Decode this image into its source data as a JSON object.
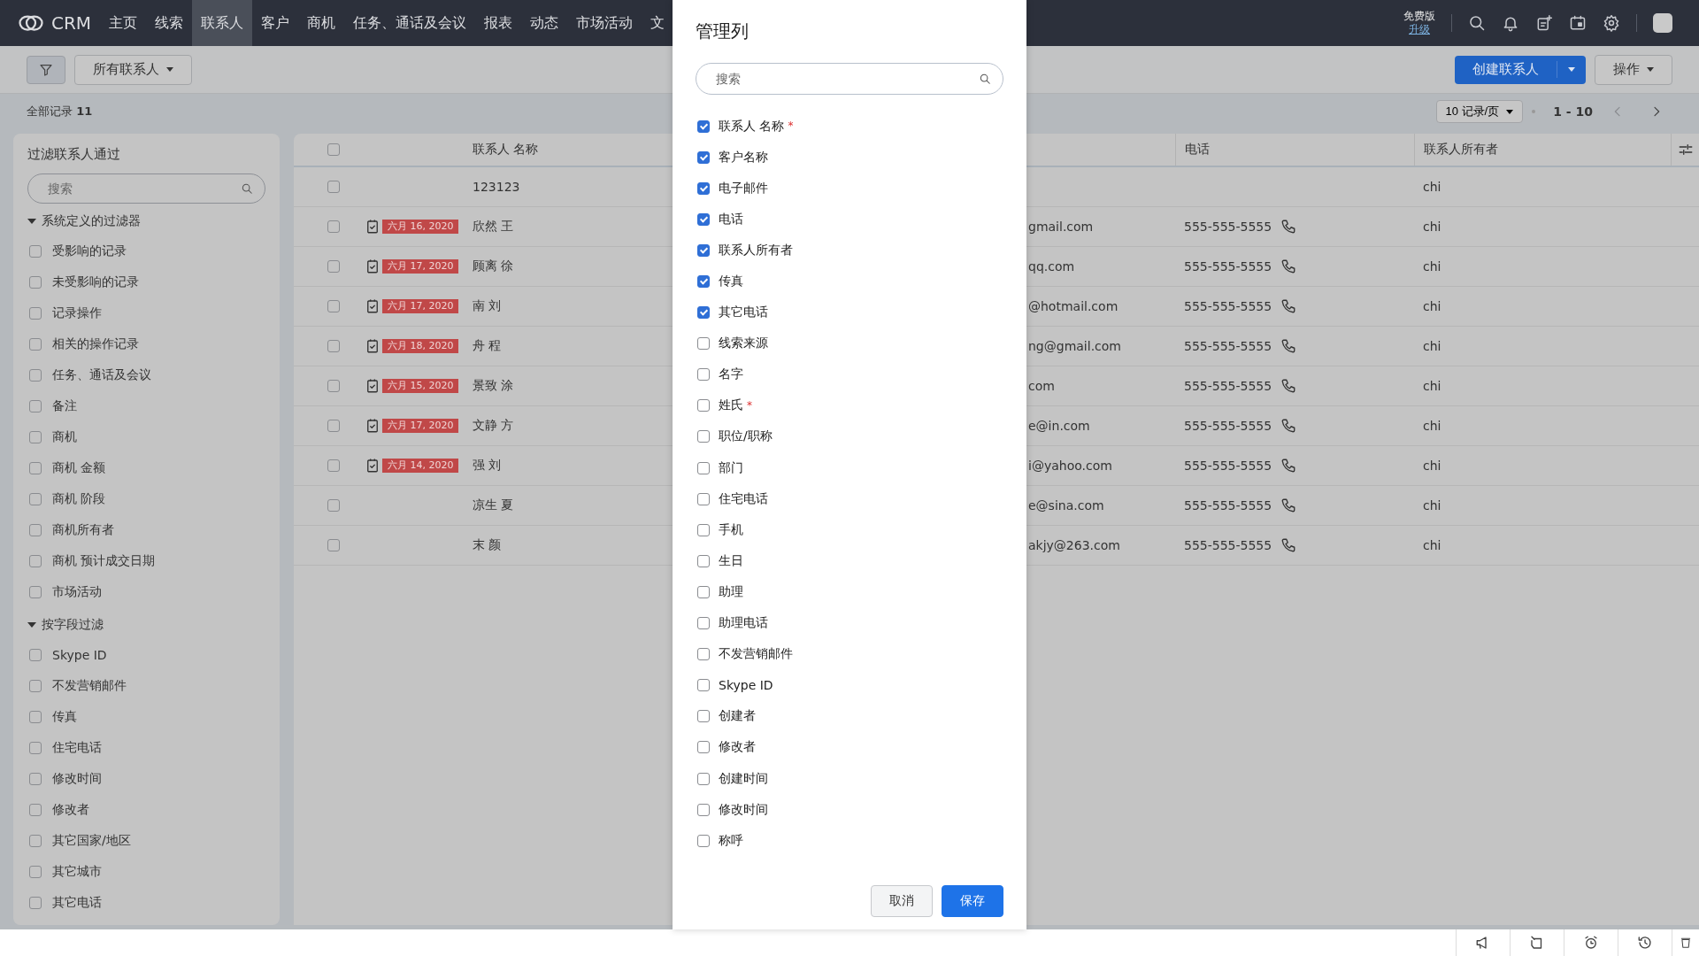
{
  "nav": {
    "logo": "CRM",
    "items": [
      {
        "label": "主页",
        "selected": false
      },
      {
        "label": "线索",
        "selected": false
      },
      {
        "label": "联系人",
        "selected": true
      },
      {
        "label": "客户",
        "selected": false
      },
      {
        "label": "商机",
        "selected": false
      },
      {
        "label": "任务、通话及会议",
        "selected": false
      },
      {
        "label": "报表",
        "selected": false
      },
      {
        "label": "动态",
        "selected": false
      },
      {
        "label": "市场活动",
        "selected": false
      },
      {
        "label": "文",
        "selected": false
      }
    ],
    "plan": "免费版",
    "upgrade": "升级"
  },
  "toolbar": {
    "view": "所有联系人",
    "create": "创建联系人",
    "actions": "操作"
  },
  "summary": {
    "records": "全部记录 **11**",
    "per_page": "10 记录/页",
    "range": "1 - 10"
  },
  "sidebar": {
    "title": "过滤联系人通过",
    "search_placeholder": "搜索",
    "sections": [
      {
        "title": "系统定义的过滤器",
        "expanded": true,
        "items": [
          {
            "label": "受影响的记录",
            "checked": false
          },
          {
            "label": "未受影响的记录",
            "checked": false
          },
          {
            "label": "记录操作",
            "checked": false
          },
          {
            "label": "相关的操作记录",
            "checked": false
          },
          {
            "label": "任务、通话及会议",
            "checked": false
          },
          {
            "label": "备注",
            "checked": false
          },
          {
            "label": "商机",
            "checked": false
          },
          {
            "label": "商机 金额",
            "checked": false
          },
          {
            "label": "商机 阶段",
            "checked": false
          },
          {
            "label": "商机所有者",
            "checked": false
          },
          {
            "label": "商机 预计成交日期",
            "checked": false
          },
          {
            "label": "市场活动",
            "checked": false
          }
        ]
      },
      {
        "title": "按字段过滤",
        "expanded": true,
        "items": [
          {
            "label": "Skype ID",
            "checked": false
          },
          {
            "label": "不发营销邮件",
            "checked": false
          },
          {
            "label": "传真",
            "checked": false
          },
          {
            "label": "住宅电话",
            "checked": false
          },
          {
            "label": "修改时间",
            "checked": false
          },
          {
            "label": "修改者",
            "checked": false
          },
          {
            "label": "其它国家/地区",
            "checked": false
          },
          {
            "label": "其它城市",
            "checked": false
          },
          {
            "label": "其它电话",
            "checked": false
          }
        ]
      }
    ]
  },
  "table": {
    "header_checked": false,
    "columns": [
      "联系人 名称",
      "电话",
      "联系人所有者"
    ],
    "rows": [
      {
        "checked": false,
        "name": "123123",
        "email": "",
        "phone": "",
        "owner": "chi"
      },
      {
        "checked": false,
        "task_date": "六月 16, 2020",
        "name": "欣然 王",
        "email": "gmail.com",
        "phone": "555-555-5555",
        "owner": "chi"
      },
      {
        "checked": false,
        "task_date": "六月 17, 2020",
        "name": "顾离 徐",
        "email": "qq.com",
        "phone": "555-555-5555",
        "owner": "chi"
      },
      {
        "checked": false,
        "task_date": "六月 17, 2020",
        "name": "南 刘",
        "email": "@hotmail.com",
        "phone": "555-555-5555",
        "owner": "chi"
      },
      {
        "checked": false,
        "task_date": "六月 18, 2020",
        "name": "舟 程",
        "email": "ng@gmail.com",
        "phone": "555-555-5555",
        "owner": "chi"
      },
      {
        "checked": false,
        "task_date": "六月 15, 2020",
        "name": "景致 涂",
        "email": "com",
        "phone": "555-555-5555",
        "owner": "chi"
      },
      {
        "checked": false,
        "task_date": "六月 17, 2020",
        "name": "文静 方",
        "email": "e@in.com",
        "phone": "555-555-5555",
        "owner": "chi"
      },
      {
        "checked": false,
        "task_date": "六月 14, 2020",
        "name": "强 刘",
        "email": "i@yahoo.com",
        "phone": "555-555-5555",
        "owner": "chi"
      },
      {
        "checked": false,
        "name": "凉生 夏",
        "email": "e@sina.com",
        "phone": "555-555-5555",
        "owner": "chi"
      },
      {
        "checked": false,
        "name": "末 颜",
        "email": "akjy@263.com",
        "phone": "555-555-5555",
        "owner": "chi"
      }
    ]
  },
  "dialog": {
    "title": "管理列",
    "search_placeholder": "搜索",
    "fields": [
      {
        "label": "联系人 名称",
        "required_mark": "*",
        "checked": true
      },
      {
        "label": "客户名称",
        "checked": true
      },
      {
        "label": "电子邮件",
        "checked": true
      },
      {
        "label": "电话",
        "checked": true
      },
      {
        "label": "联系人所有者",
        "checked": true
      },
      {
        "label": "传真",
        "checked": true
      },
      {
        "label": "其它电话",
        "checked": true
      },
      {
        "label": "线索来源",
        "checked": false
      },
      {
        "label": "名字",
        "checked": false
      },
      {
        "label": "姓氏",
        "required_mark": "*",
        "checked": false
      },
      {
        "label": "职位/职称",
        "checked": false
      },
      {
        "label": "部门",
        "checked": false
      },
      {
        "label": "住宅电话",
        "checked": false
      },
      {
        "label": "手机",
        "checked": false
      },
      {
        "label": "生日",
        "checked": false
      },
      {
        "label": "助理",
        "checked": false
      },
      {
        "label": "助理电话",
        "checked": false
      },
      {
        "label": "不发营销邮件",
        "checked": false
      },
      {
        "label": "Skype ID",
        "checked": false
      },
      {
        "label": "创建者",
        "checked": false
      },
      {
        "label": "修改者",
        "checked": false
      },
      {
        "label": "创建时间",
        "checked": false
      },
      {
        "label": "修改时间",
        "checked": false
      },
      {
        "label": "称呼",
        "checked": false
      }
    ],
    "cancel": "取消",
    "save": "保存"
  }
}
